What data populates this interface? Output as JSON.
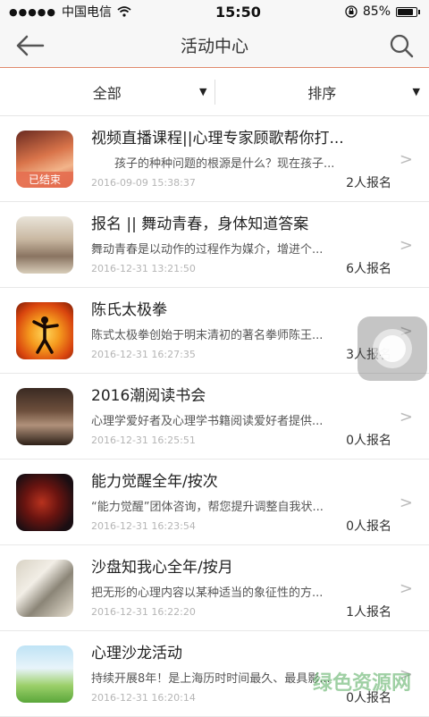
{
  "status": {
    "signal_dots": "●●●●●",
    "carrier": "中国电信",
    "time": "15:50",
    "battery": "85%"
  },
  "nav": {
    "title": "活动中心"
  },
  "filters": {
    "all": "全部",
    "sort": "排序"
  },
  "items": [
    {
      "title": "视频直播课程||心理专家顾歌帮你打...",
      "desc": "孩子的种种问题的根源是什么？现在孩子...",
      "date": "2016-09-09 15:38:37",
      "count": "2人报名",
      "badge": "已结束"
    },
    {
      "title": "报名 || 舞动青春，身体知道答案",
      "desc": "舞动青春是以动作的过程作为媒介，增进个...",
      "date": "2016-12-31 13:21:50",
      "count": "6人报名"
    },
    {
      "title": "陈氏太极拳",
      "desc": "陈式太极拳创始于明末清初的著名拳师陈王...",
      "date": "2016-12-31 16:27:35",
      "count": "3人报名"
    },
    {
      "title": "2016潮阅读书会",
      "desc": "心理学爱好者及心理学书籍阅读爱好者提供...",
      "date": "2016-12-31 16:25:51",
      "count": "0人报名"
    },
    {
      "title": "能力觉醒全年/按次",
      "desc": "“能力觉醒”团体咨询，帮您提升调整自我状...",
      "date": "2016-12-31 16:23:54",
      "count": "0人报名"
    },
    {
      "title": "沙盘知我心全年/按月",
      "desc": "把无形的心理内容以某种适当的象征性的方...",
      "date": "2016-12-31 16:22:20",
      "count": "1人报名"
    },
    {
      "title": "心理沙龙活动",
      "desc": "持续开展8年！是上海历时时间最久、最具影...",
      "date": "2016-12-31 16:20:14",
      "count": "0人报名"
    }
  ],
  "watermark": "绿色资源网"
}
